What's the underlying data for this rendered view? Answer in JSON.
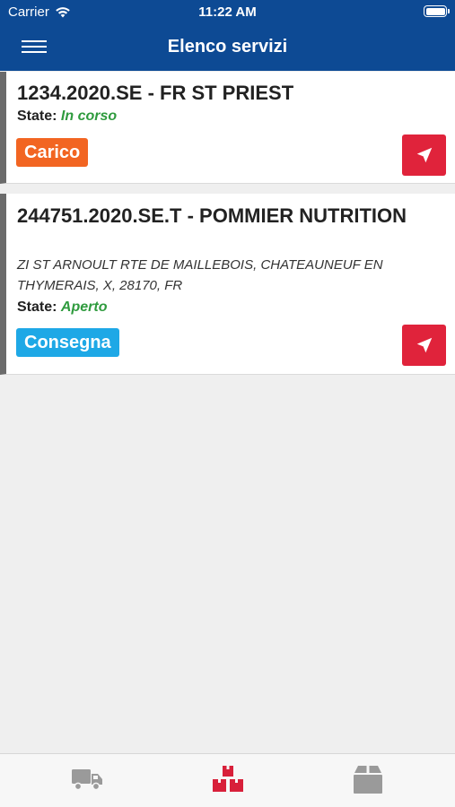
{
  "status_bar": {
    "carrier": "Carrier",
    "time": "11:22 AM"
  },
  "header": {
    "title": "Elenco servizi"
  },
  "services": [
    {
      "code": "1234.2020.SE - FR ST PRIEST",
      "address": "",
      "state_label": "State:",
      "state_value": "In corso",
      "badge": "Carico",
      "badge_color": "#f26522"
    },
    {
      "code": "244751.2020.SE.T - POMMIER NUTRITION",
      "address": "ZI ST ARNOULT RTE DE MAILLEBOIS, CHATEAUNEUF EN THYMERAIS, X, 28170, FR",
      "state_label": "State:",
      "state_value": "Aperto",
      "badge": "Consegna",
      "badge_color": "#1ea8e6"
    }
  ],
  "tabs": [
    {
      "icon": "truck-icon",
      "active": false
    },
    {
      "icon": "boxes-icon",
      "active": true
    },
    {
      "icon": "package-icon",
      "active": false
    }
  ],
  "colors": {
    "header": "#0d4a94",
    "accent_red": "#e0233b",
    "state_green": "#2f9b3e",
    "tab_inactive": "#9a9a9a"
  }
}
